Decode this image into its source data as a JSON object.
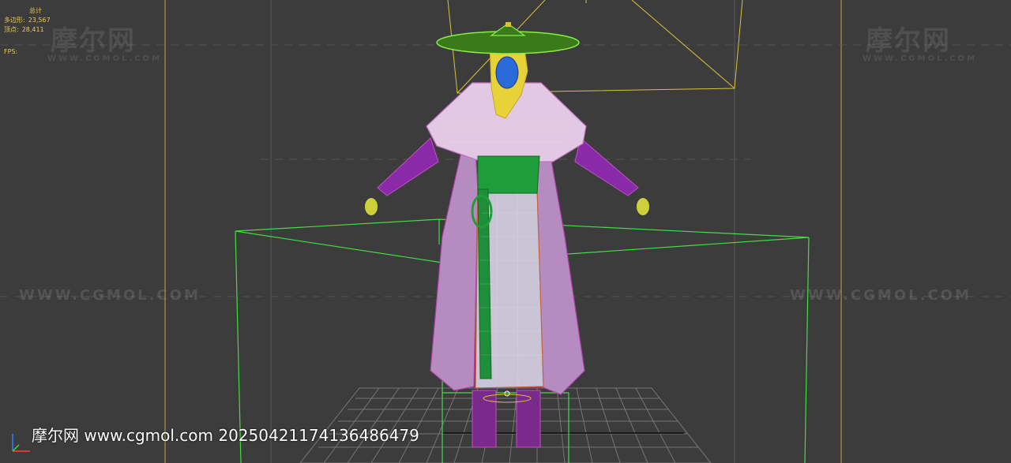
{
  "viewport": {
    "background": "#3c3c3c",
    "colors": {
      "grid": "#8a8a8a",
      "frame_yellow": "#d8c23a",
      "bbox_green": "#44dd44",
      "robe_pink": "#e2c8e2",
      "wire_magenta": "#b040b0",
      "sash_green": "#1e9e3a",
      "hat_green": "#3a7a1a",
      "hair_yellow": "#e8d23a",
      "face_blue": "#2a6ad8",
      "apron_orange": "#c8603a"
    }
  },
  "stats": {
    "total_label": "总计",
    "polygons_label": "多边形:",
    "polygons_value": "23,567",
    "vertices_label": "顶点:",
    "vertices_value": "28,411",
    "fps_label": "FPS:"
  },
  "watermarks": {
    "logo_text": "摩尔网",
    "logo_sub": "WWW.CGMOL.COM",
    "url_text": "WWW.CGMOL.COM"
  },
  "caption": {
    "text": "摩尔网 www.cgmol.com 20250421174136486479"
  }
}
